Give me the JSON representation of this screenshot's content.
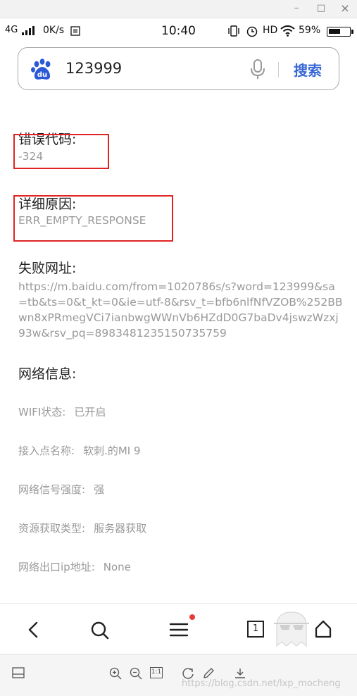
{
  "window": {
    "minimize_glyph": "–",
    "maximize_glyph": "□",
    "close_glyph": "×"
  },
  "status_bar": {
    "network": "4G",
    "speed": "0K/s",
    "time": "10:40",
    "hd": "HD",
    "battery": "59%",
    "battery_level": 0.59,
    "icons": [
      "signal-icon",
      "storage-icon",
      "vibrate-icon",
      "alarm-icon",
      "wifi-icon",
      "battery-icon"
    ]
  },
  "search": {
    "query": "123999",
    "button": "搜索",
    "logo_text": "du",
    "logo_color": "#2b58d6",
    "button_color": "#3867d6"
  },
  "error": {
    "code_label": "错误代码:",
    "code_value": "-324",
    "reason_label": "详细原因:",
    "reason_value": "ERR_EMPTY_RESPONSE",
    "url_label": "失败网址:",
    "url_value": "https://m.baidu.com/from=1020786s/s?word=123999&sa=tb&ts=0&t_kt=0&ie=utf-8&rsv_t=bfb6nlfNfVZOB%252BBwn8xPRmegVCi7ianbwgWWnVb6HZdD0G7baDv4jswzWzxj93w&rsv_pq=8983481235150735759"
  },
  "network": {
    "title": "网络信息:",
    "items": [
      {
        "label": "WIFI状态:",
        "value": "已开启"
      },
      {
        "label": "接入点名称:",
        "value": "软刺.的MI 9"
      },
      {
        "label": "网络信号强度:",
        "value": "强"
      },
      {
        "label": "资源获取类型:",
        "value": "服务器获取"
      },
      {
        "label": "网络出口ip地址:",
        "value": "None"
      }
    ]
  },
  "bottom_nav": {
    "tab_count": "1",
    "notification_color": "#e63b3b"
  },
  "toolbar": {
    "actual_size": "1:1",
    "watermark": "https://blog.csdn.net/lxp_mocheng"
  },
  "highlight_color": "#e02424"
}
